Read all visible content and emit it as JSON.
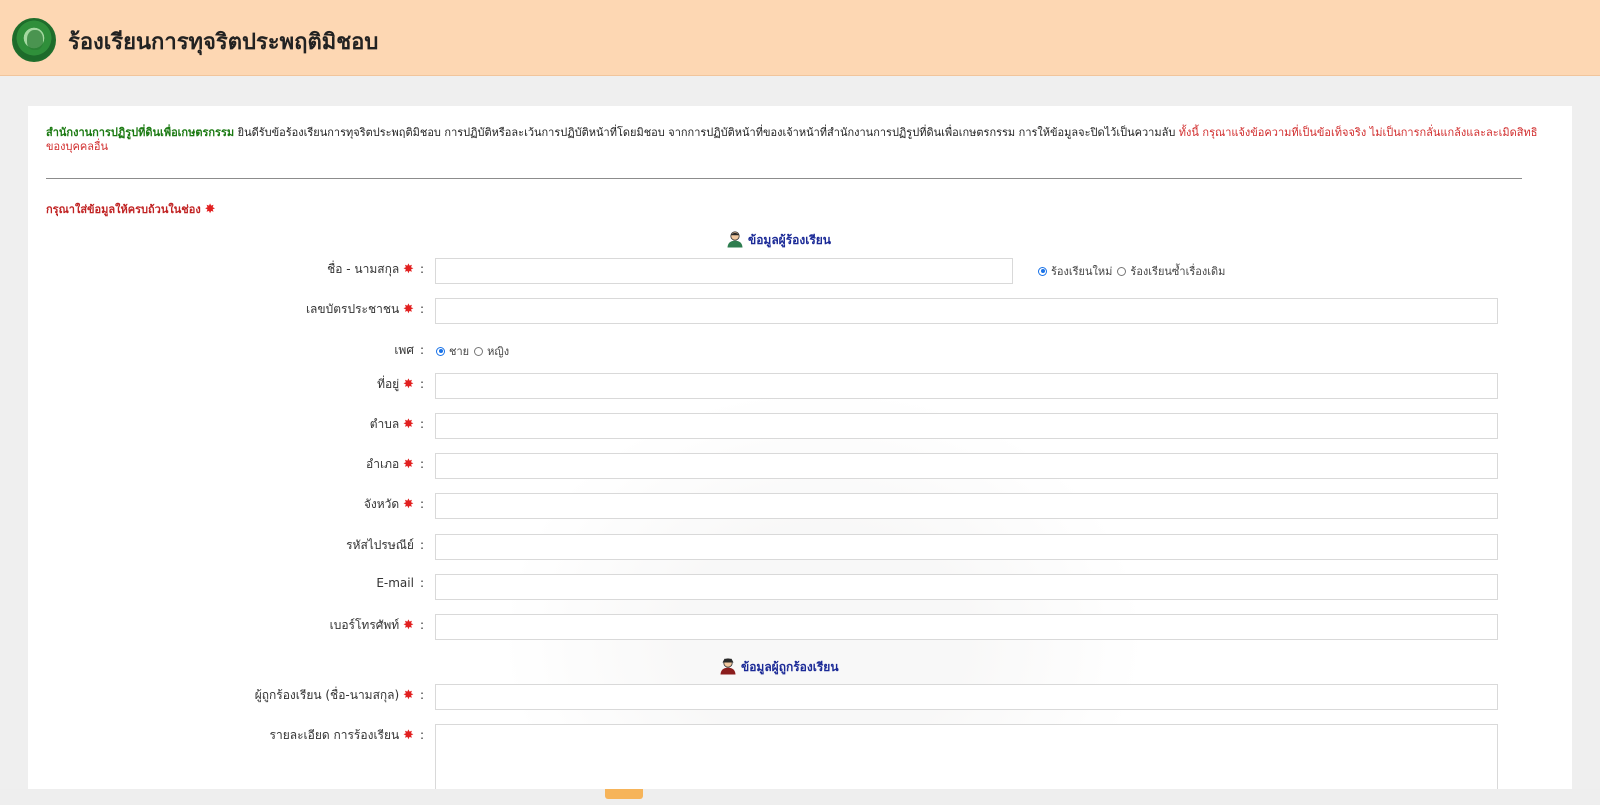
{
  "header": {
    "title": "ร้องเรียนการทุจริตประพฤติมิชอบ"
  },
  "intro": {
    "org_name": "สำนักงานการปฏิรูปที่ดินเพื่อเกษตรกรรม",
    "text": " ยินดีรับข้อร้องเรียนการทุจริตประพฤติมิชอบ การปฏิบัติหรือละเว้นการปฏิบัติหน้าที่โดยมิชอบ จากการปฏิบัติหน้าที่ของเจ้าหน้าที่สำนักงานการปฏิรูปที่ดินเพื่อเกษตรกรรม การให้ข้อมูลจะปิดไว้เป็นความลับ ",
    "warning": "ทั้งนี้ กรุณาแจ้งข้อความที่เป็นข้อเท็จจริง ไม่เป็นการกลั่นแกล้งและละเมิดสิทธิของบุคคลอื่น"
  },
  "required_note": "กรุณาใส่ข้อมูลให้ครบถ้วนในช่อง",
  "required_mark": "✸",
  "colon": ":",
  "section_complainant": {
    "title": "ข้อมูลผู้ร้องเรียน"
  },
  "section_accused": {
    "title": "ข้อมูลผู้ถูกร้องเรียน"
  },
  "fields": {
    "fullname": {
      "label": "ชื่อ - นามสกุล",
      "value": "",
      "placeholder": ""
    },
    "id_card": {
      "label": "เลขบัตรประชาชน",
      "value": "",
      "placeholder": ""
    },
    "gender": {
      "label": "เพศ"
    },
    "address": {
      "label": "ที่อยู่",
      "value": "",
      "placeholder": ""
    },
    "subdistrict": {
      "label": "ตำบล",
      "value": "",
      "placeholder": ""
    },
    "district": {
      "label": "อำเภอ",
      "value": "",
      "placeholder": ""
    },
    "province": {
      "label": "จังหวัด",
      "value": "",
      "placeholder": ""
    },
    "postal_code": {
      "label": "รหัสไปรษณีย์",
      "value": "",
      "placeholder": ""
    },
    "email": {
      "label": "E-mail",
      "value": "",
      "placeholder": ""
    },
    "phone": {
      "label": "เบอร์โทรศัพท์",
      "value": "",
      "placeholder": ""
    },
    "accused_name": {
      "label": "ผู้ถูกร้องเรียน (ชื่อ-นามสกุล)",
      "value": "",
      "placeholder": ""
    },
    "details": {
      "label": "รายละเอียด การร้องเรียน",
      "value": "",
      "placeholder": ""
    }
  },
  "complaint_type": {
    "options": [
      "ร้องเรียนใหม่",
      "ร้องเรียนซ้ำเรื่องเดิม"
    ],
    "selected": "ร้องเรียนใหม่"
  },
  "gender_options": {
    "options": [
      "ชาย",
      "หญิง"
    ],
    "selected": "ชาย"
  },
  "colors": {
    "header_bg": "#fdd7b3",
    "org_green": "#1b7a12",
    "warning_red": "#d12c2c",
    "section_blue": "#1b2a97",
    "radio_blue": "#1a73e8"
  }
}
